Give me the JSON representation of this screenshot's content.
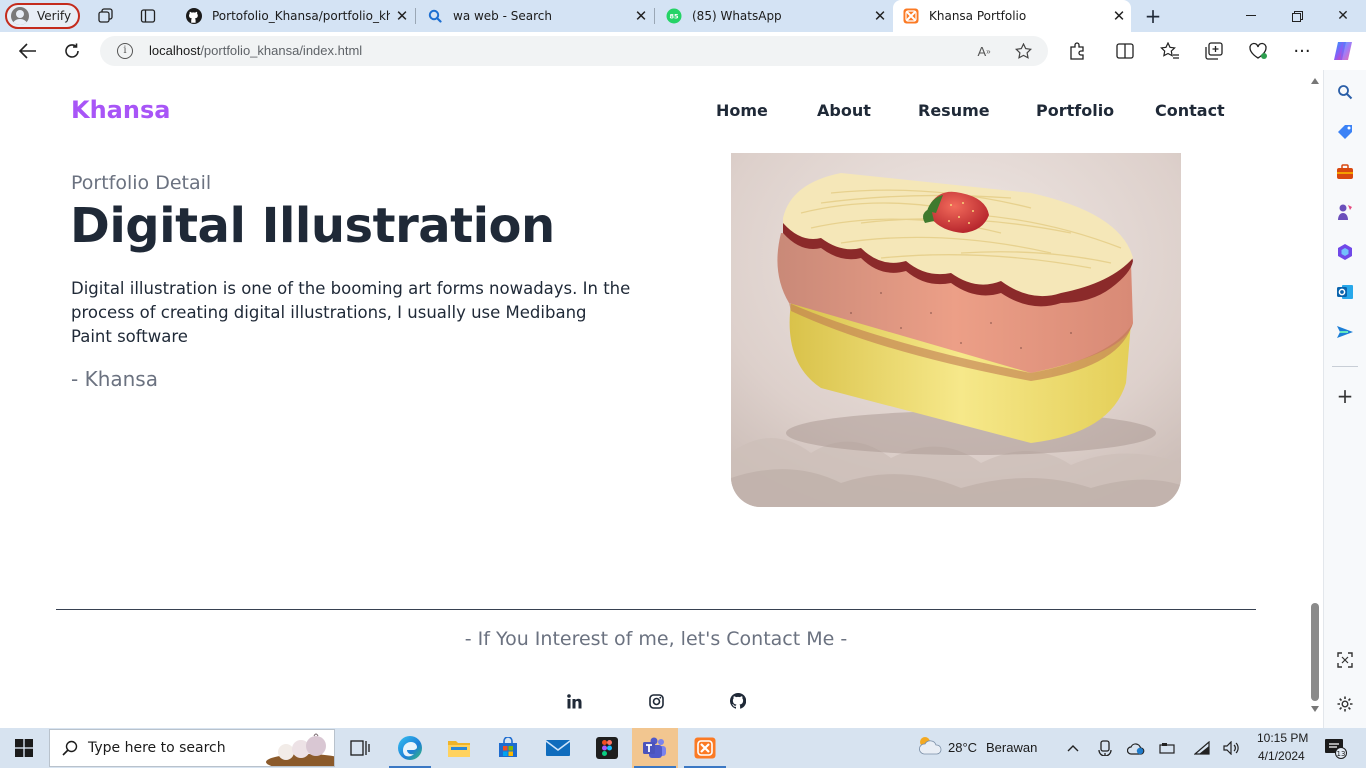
{
  "browser": {
    "profile_label": "Verify",
    "tabs": [
      {
        "title": "Portofolio_Khansa/portfolio_khansa",
        "icon": "github-icon"
      },
      {
        "title": "wa web - Search",
        "icon": "search-icon"
      },
      {
        "title": "(85) WhatsApp",
        "icon": "whatsapp-icon",
        "badge": "85"
      },
      {
        "title": "Khansa Portfolio",
        "icon": "xampp-icon",
        "active": true
      }
    ],
    "url_host": "localhost",
    "url_path": "/portfolio_khansa/index.html"
  },
  "page": {
    "logo": "Khansa",
    "nav": [
      "Home",
      "About",
      "Resume",
      "Portfolio",
      "Contact"
    ],
    "eyebrow": "Portfolio Detail",
    "title": "Digital Illustration",
    "description": "Digital illustration is one of the booming art forms nowadays. In the process of creating digital illustrations, I usually use Medibang Paint software",
    "author": "- Khansa",
    "contact_line": "- If You Interest of me, let's Contact Me -",
    "social": [
      "linkedin-icon",
      "instagram-icon",
      "github-icon"
    ],
    "brand_color": "#a855f7",
    "text_color": "#1f2937",
    "muted_color": "#6b7280"
  },
  "taskbar": {
    "search_placeholder": "Type here to search",
    "weather_temp": "28°C",
    "weather_text": "Berawan",
    "time": "10:15 PM",
    "date": "4/1/2024",
    "notification_count": "13"
  }
}
